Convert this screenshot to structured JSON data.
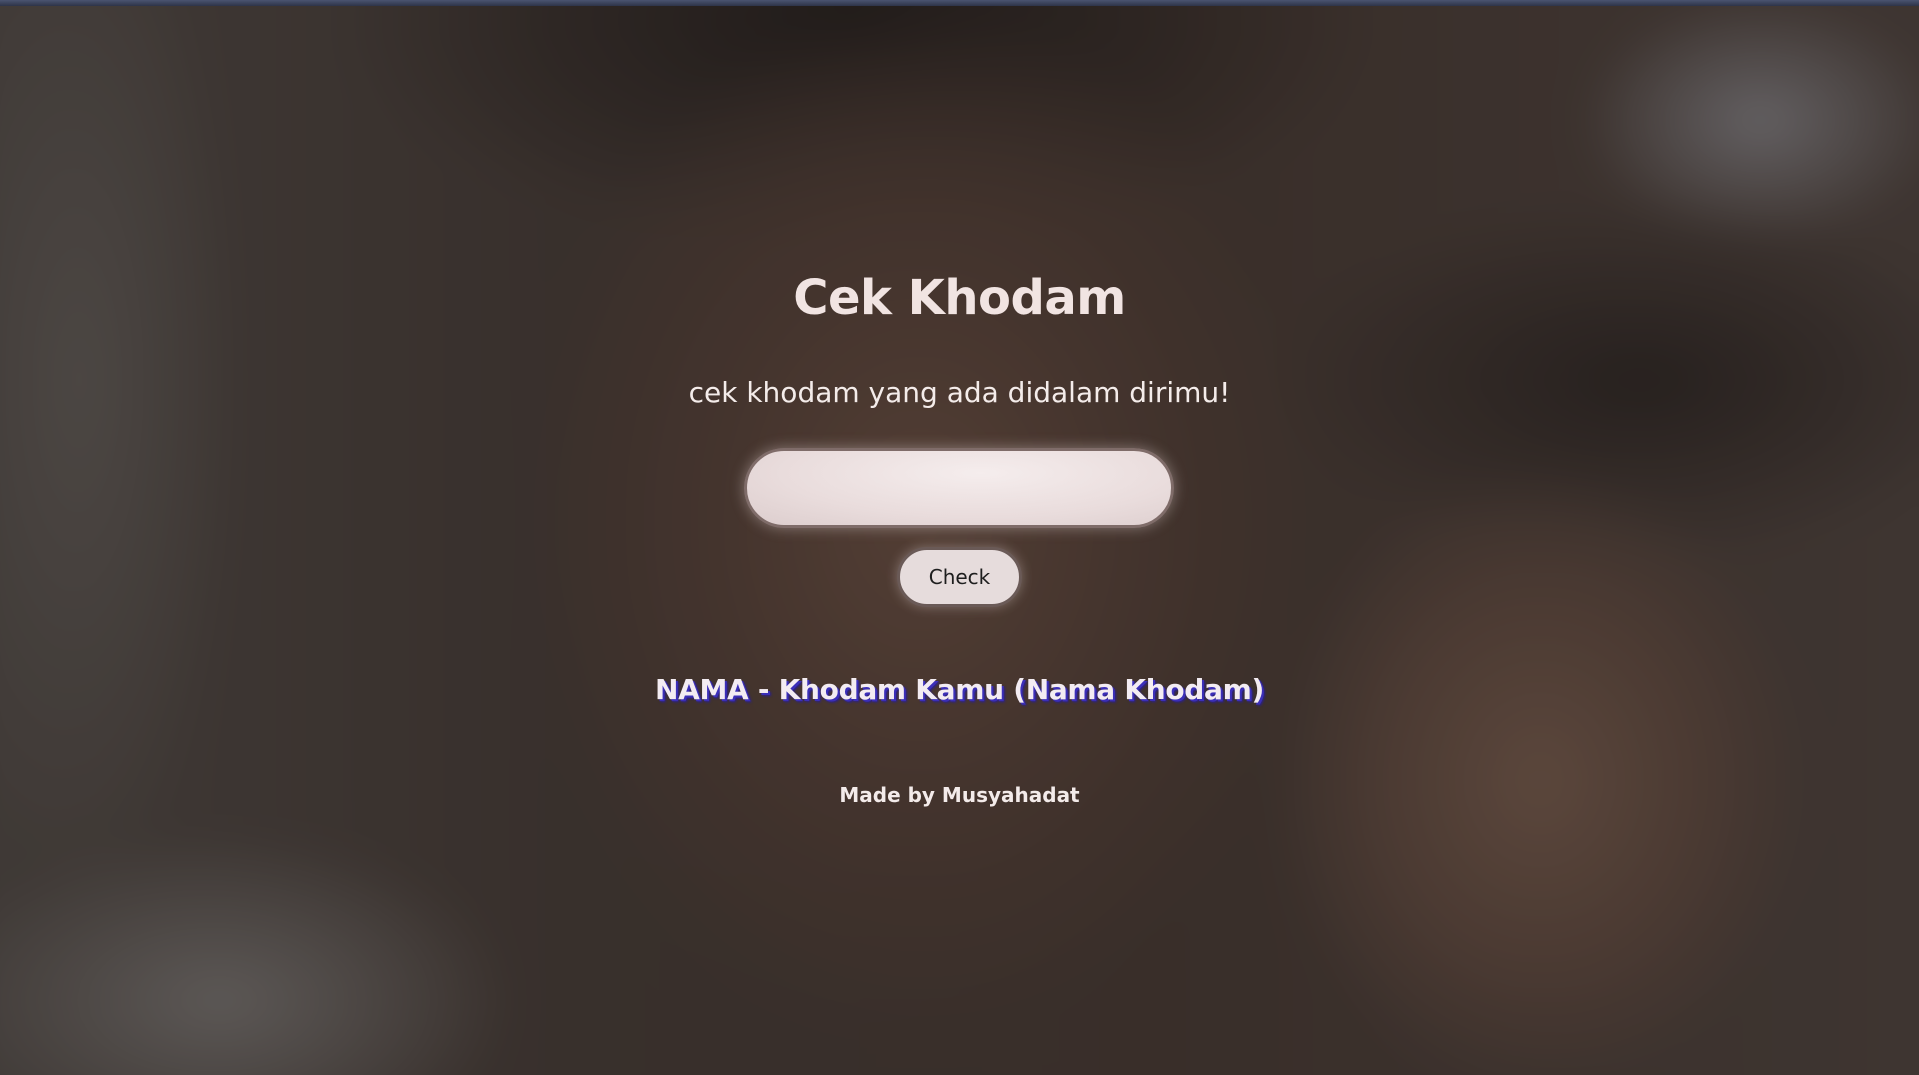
{
  "header": {
    "title": "Cek Khodam",
    "subtitle": "cek khodam yang ada didalam dirimu!"
  },
  "form": {
    "name_input_value": "",
    "name_input_placeholder": "",
    "check_label": "Check"
  },
  "result": {
    "text": "NAMA - Khodam Kamu (Nama Khodam)"
  },
  "footer": {
    "credit": "Made by Musyahadat"
  },
  "colors": {
    "title": "#f1e4e2",
    "input_bg": "#e9dcdc",
    "button_bg": "#e6dcdc",
    "result_shadow": "#3c2fb8",
    "overlay": "#231c1a"
  }
}
